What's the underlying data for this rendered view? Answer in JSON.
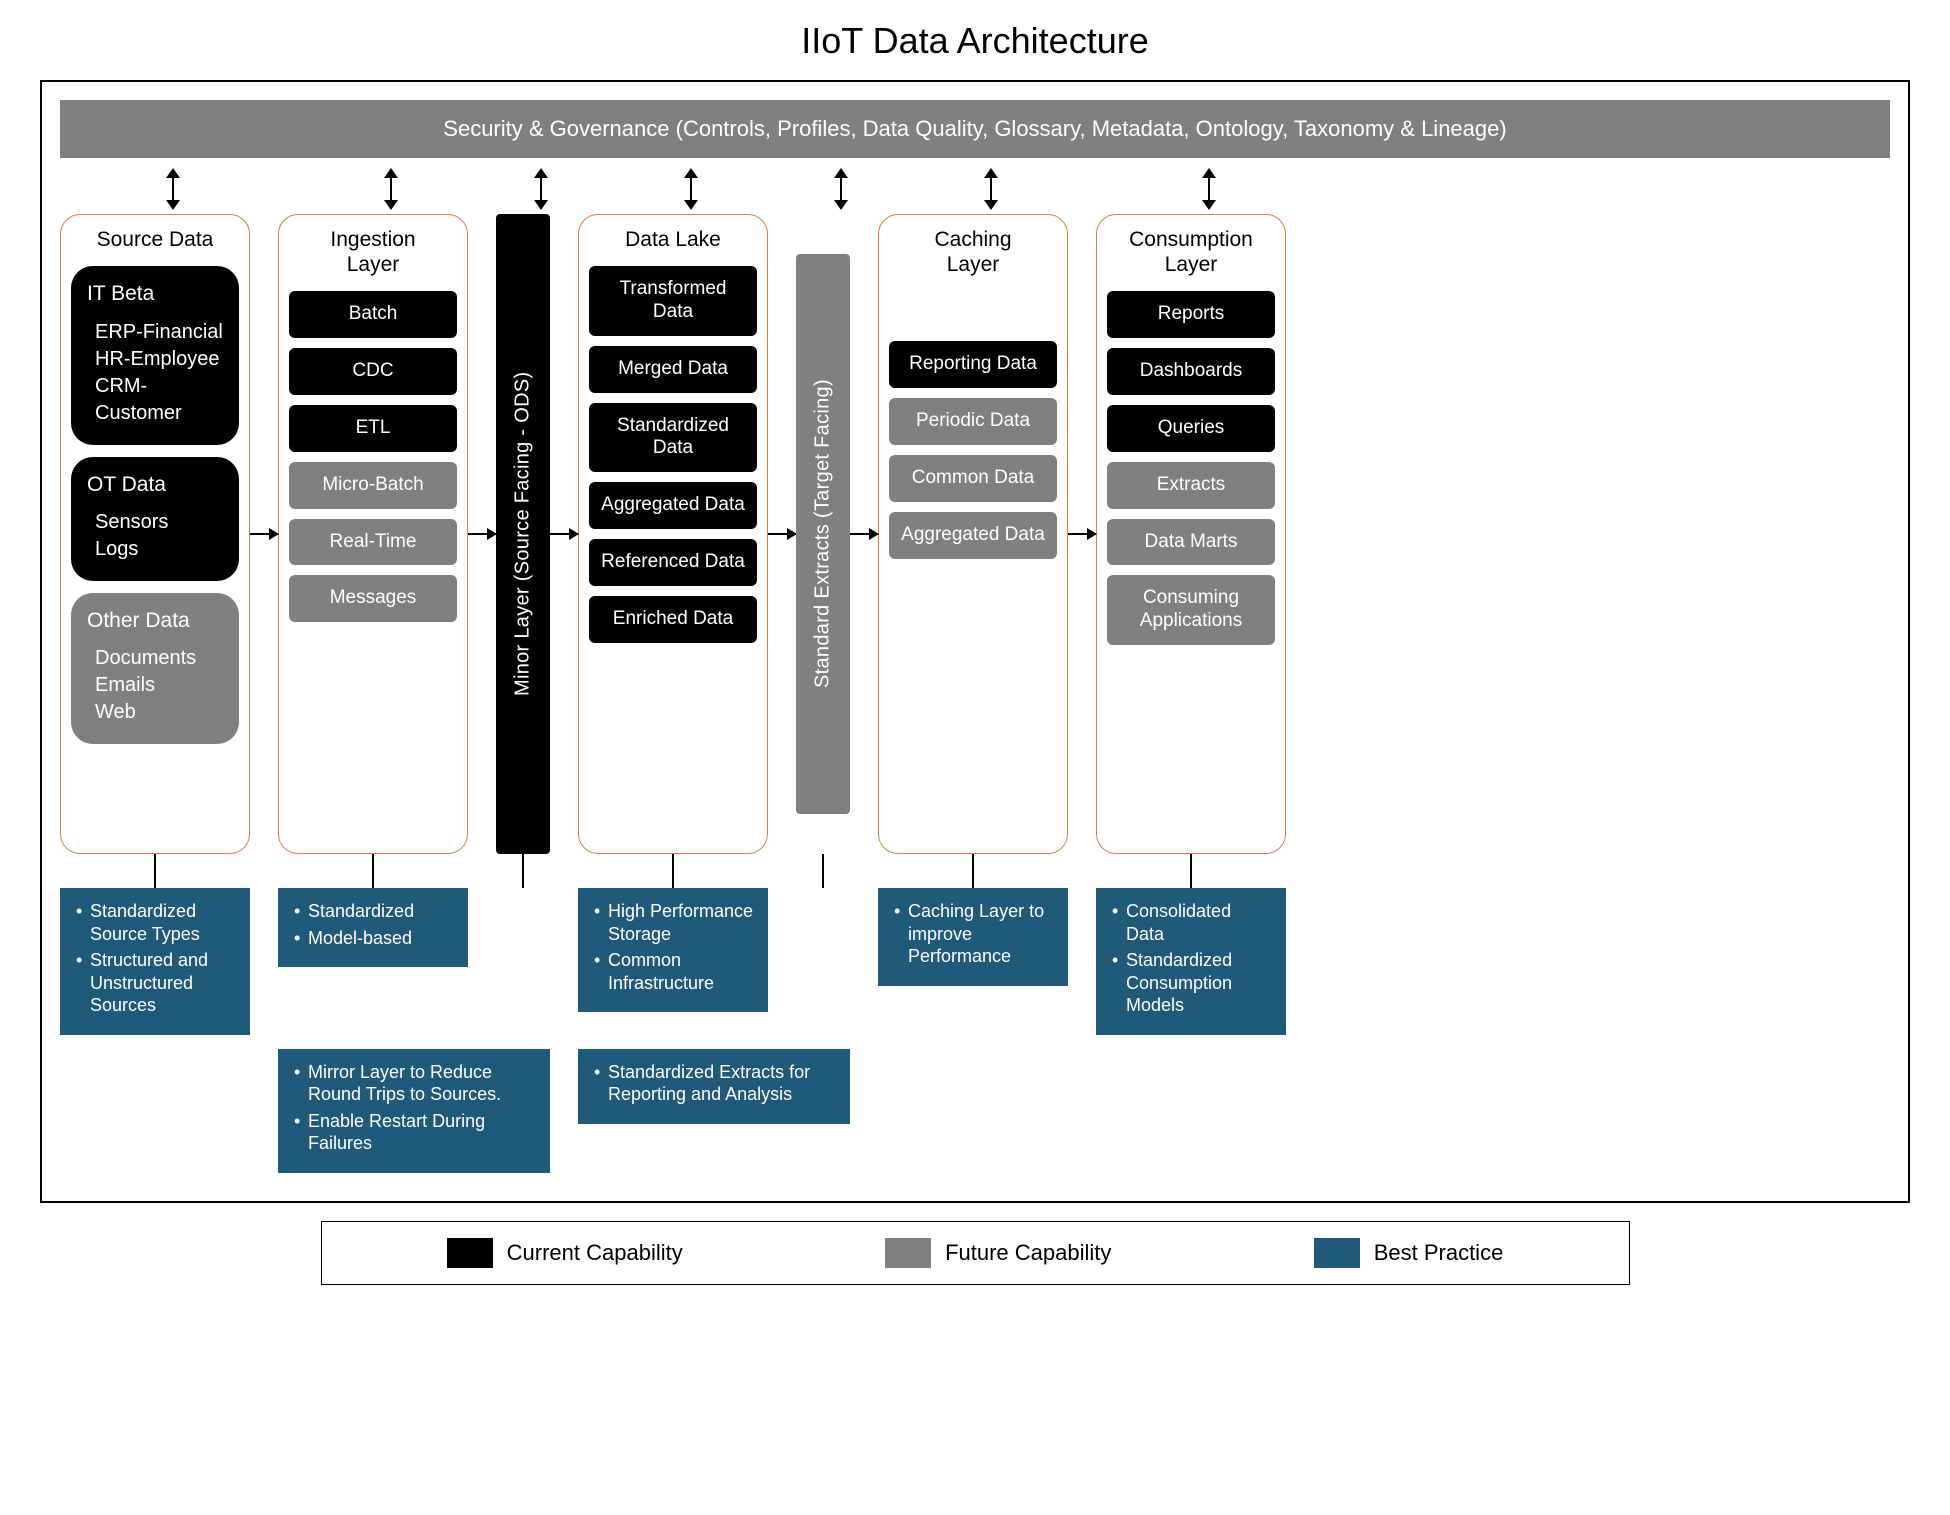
{
  "title": "IIoT Data Architecture",
  "governance": "Security & Governance (Controls, Profiles, Data Quality, Glossary, Metadata, Ontology, Taxonomy & Lineage)",
  "columns": {
    "source": {
      "title": "Source Data",
      "blocks": [
        {
          "heading": "IT Beta",
          "lines": [
            "ERP-Financial",
            "HR-Employee",
            "CRM-Customer"
          ],
          "style": "black"
        },
        {
          "heading": "OT Data",
          "lines": [
            "Sensors",
            "Logs"
          ],
          "style": "black"
        },
        {
          "heading": "Other Data",
          "lines": [
            "Documents",
            "Emails",
            "Web"
          ],
          "style": "gray"
        }
      ],
      "note": [
        "Standardized Source Types",
        "Structured and Unstructured Sources"
      ]
    },
    "ingestion": {
      "title": "Ingestion\nLayer",
      "items": [
        {
          "label": "Batch",
          "style": "black"
        },
        {
          "label": "CDC",
          "style": "black"
        },
        {
          "label": "ETL",
          "style": "black"
        },
        {
          "label": "Micro-Batch",
          "style": "gray"
        },
        {
          "label": "Real-Time",
          "style": "gray"
        },
        {
          "label": "Messages",
          "style": "gray"
        }
      ],
      "note": [
        "Standardized",
        "Model-based"
      ]
    },
    "mirror_bar": {
      "label": "Minor Layer (Source Facing - ODS)",
      "style": "black",
      "note": [
        "Mirror Layer to Reduce Round Trips to Sources.",
        "Enable Restart During Failures"
      ]
    },
    "datalake": {
      "title": "Data Lake",
      "items": [
        {
          "label": "Transformed Data",
          "style": "black"
        },
        {
          "label": "Merged Data",
          "style": "black"
        },
        {
          "label": "Standardized Data",
          "style": "black"
        },
        {
          "label": "Aggregated Data",
          "style": "black"
        },
        {
          "label": "Referenced Data",
          "style": "black"
        },
        {
          "label": "Enriched Data",
          "style": "black"
        }
      ],
      "note": [
        "High Performance Storage",
        "Common Infrastructure"
      ]
    },
    "extracts_bar": {
      "label": "Standard Extracts (Target Facing)",
      "style": "gray",
      "note": [
        "Standardized Extracts for Reporting and Analysis"
      ]
    },
    "caching": {
      "title": "Caching\nLayer",
      "items": [
        {
          "label": "Reporting Data",
          "style": "black"
        },
        {
          "label": "Periodic Data",
          "style": "gray"
        },
        {
          "label": "Common Data",
          "style": "gray"
        },
        {
          "label": "Aggregated Data",
          "style": "gray"
        }
      ],
      "note": [
        "Caching Layer to improve Performance"
      ]
    },
    "consumption": {
      "title": "Consumption\nLayer",
      "items": [
        {
          "label": "Reports",
          "style": "black"
        },
        {
          "label": "Dashboards",
          "style": "black"
        },
        {
          "label": "Queries",
          "style": "black"
        },
        {
          "label": "Extracts",
          "style": "gray"
        },
        {
          "label": "Data Marts",
          "style": "gray"
        },
        {
          "label": "Consuming Applications",
          "style": "gray"
        }
      ],
      "note": [
        "Consolidated Data",
        "Standardized Consumption Models"
      ]
    }
  },
  "legend": {
    "current": "Current Capability",
    "future": "Future Capability",
    "best": "Best Practice"
  },
  "colors": {
    "current": "#000000",
    "future": "#808080",
    "best": "#1f5a7a",
    "panel_border": "#e67a3c"
  }
}
